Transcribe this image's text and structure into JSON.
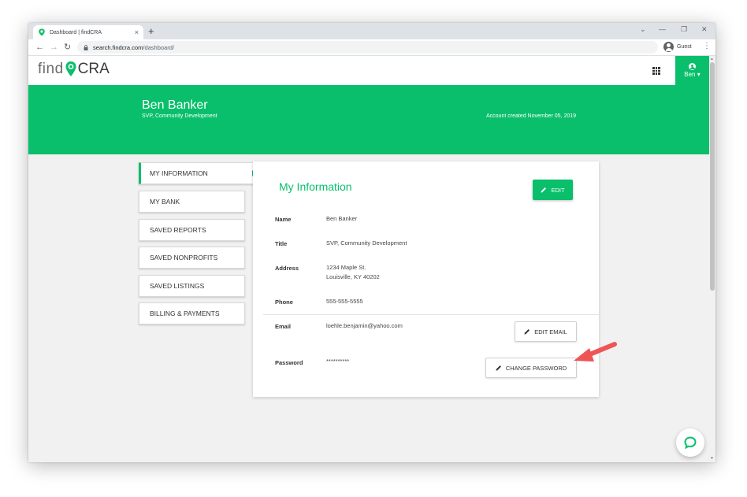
{
  "browser": {
    "tab_title": "Dashboard | findCRA",
    "tab_close": "×",
    "new_tab": "+",
    "url_host": "search.findcra.com",
    "url_path": "/dashboard/",
    "profile_label": "Guest",
    "controls": {
      "minimize": "—",
      "restore": "❐",
      "close": "✕",
      "tab_search": "⌄"
    },
    "nav": {
      "back": "←",
      "forward": "→",
      "reload": "↻",
      "menu": "⋮"
    }
  },
  "header": {
    "logo_left": "find",
    "logo_right": "CRA",
    "user_menu_label": "Ben ▾"
  },
  "banner": {
    "name": "Ben Banker",
    "title": "SVP, Community Development",
    "account_created": "Account created November 05, 2019"
  },
  "sidebar": {
    "items": [
      {
        "label": "MY INFORMATION"
      },
      {
        "label": "MY BANK"
      },
      {
        "label": "SAVED REPORTS"
      },
      {
        "label": "SAVED NONPROFITS"
      },
      {
        "label": "SAVED LISTINGS"
      },
      {
        "label": "BILLING & PAYMENTS"
      }
    ]
  },
  "card": {
    "title": "My Information",
    "edit_label": "EDIT",
    "fields": {
      "name": {
        "label": "Name",
        "value": "Ben Banker"
      },
      "title": {
        "label": "Title",
        "value": "SVP, Community Development"
      },
      "address": {
        "label": "Address",
        "line1": "1234 Maple St.",
        "line2": "Louisville, KY 40202"
      },
      "phone": {
        "label": "Phone",
        "value": "555-555-5555"
      },
      "email": {
        "label": "Email",
        "value": "loehle.benjamin@yahoo.com"
      },
      "password": {
        "label": "Password",
        "value": "**********"
      }
    },
    "edit_email_label": "EDIT EMAIL",
    "change_password_label": "CHANGE PASSWORD"
  },
  "colors": {
    "brand_green": "#09bf6b",
    "annotation_arrow": "#f05555"
  },
  "icons": {
    "apps": "apps-grid-icon",
    "chat": "chat-icon",
    "edit": "pencil-icon"
  }
}
